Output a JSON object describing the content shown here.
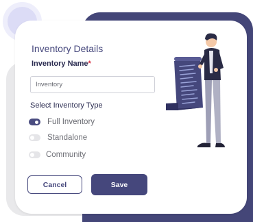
{
  "dialog": {
    "title": "Inventory Details",
    "name_label": "Inventory Name",
    "required_mark": "*",
    "name_placeholder": "Inventory",
    "name_value": "",
    "type_label": "Select Inventory Type",
    "types": [
      {
        "label": "Full Inventory",
        "selected": true
      },
      {
        "label": "Standalone",
        "selected": false
      },
      {
        "label": "Community",
        "selected": false
      }
    ],
    "cancel_label": "Cancel",
    "save_label": "Save"
  },
  "illustration": {
    "icon": "person-reading-list-illustration"
  },
  "colors": {
    "primary": "#45477c",
    "required": "#d5283d",
    "panel_gray": "#e9e9eb",
    "circle_light": "#dcdcf6"
  }
}
